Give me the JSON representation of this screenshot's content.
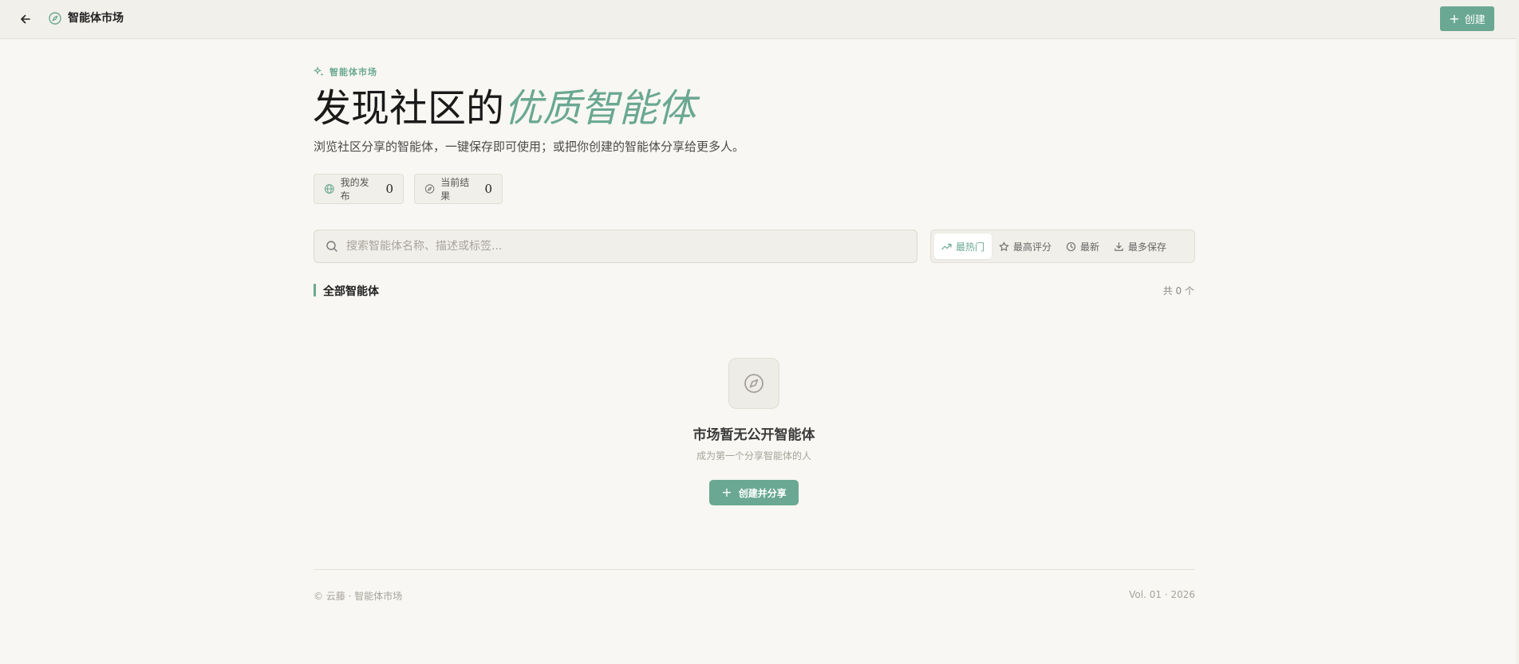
{
  "topbar": {
    "title": "智能体市场",
    "create_label": "创建",
    "icons": {
      "back": "arrow-left-icon",
      "app": "compass-icon",
      "create": "plus-icon"
    }
  },
  "hero": {
    "eyebrow": "智能体市场",
    "title_main": "发现社区的",
    "title_accent": "优质智能体",
    "subtitle": "浏览社区分享的智能体，一键保存即可使用；或把你创建的智能体分享给更多人。"
  },
  "stats": [
    {
      "label": "我的发布",
      "value": "0",
      "icon": "globe-icon"
    },
    {
      "label": "当前结果",
      "value": "0",
      "icon": "compass-icon"
    }
  ],
  "search": {
    "placeholder": "搜索智能体名称、描述或标签..."
  },
  "sort": {
    "active": "最热门",
    "items": [
      {
        "label": "最热门",
        "icon": "trending-up-icon"
      },
      {
        "label": "最高评分",
        "icon": "star-icon"
      },
      {
        "label": "最新",
        "icon": "clock-icon"
      },
      {
        "label": "最多保存",
        "icon": "download-icon"
      }
    ]
  },
  "section": {
    "title": "全部智能体",
    "count": "共 0 个"
  },
  "empty": {
    "title": "市场暂无公开智能体",
    "subtitle": "成为第一个分享智能体的人",
    "cta": "创建并分享"
  },
  "footer": {
    "left": "© 云藤 · 智能体市场",
    "right": "Vol. 01 · 2026"
  },
  "colors": {
    "accent": "#6aa893",
    "background": "#f8f7f3",
    "topbar": "#f2f0eb"
  }
}
